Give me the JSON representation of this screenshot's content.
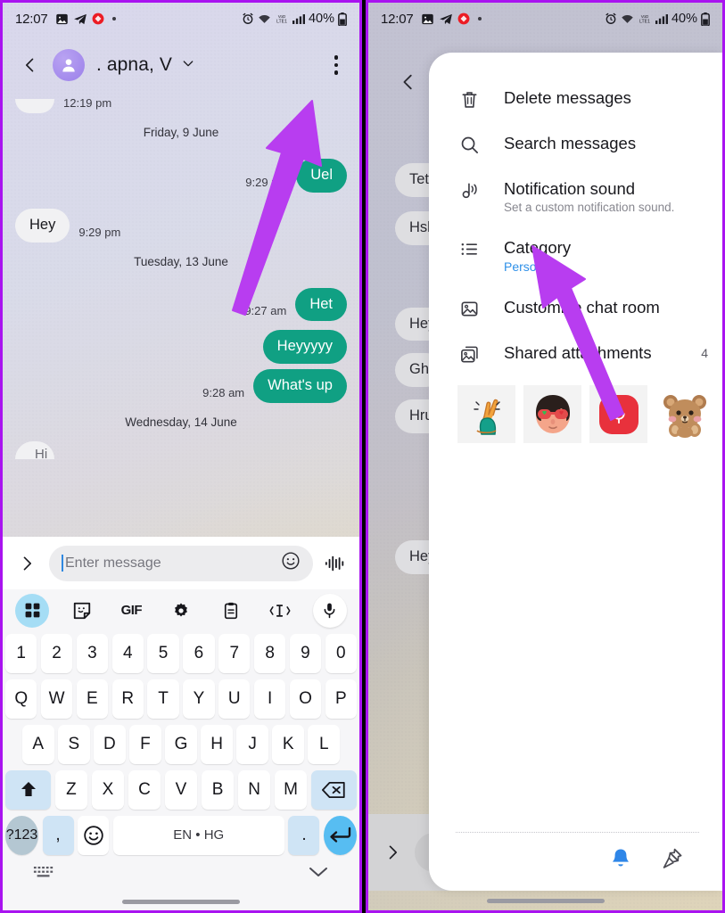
{
  "status_bar": {
    "time": "12:07",
    "left_icons": [
      "photo-icon",
      "telegram-icon",
      "record-icon",
      "dot-icon"
    ],
    "right_icons": [
      "alarm-icon",
      "wifi-icon",
      "volte-icon",
      "signal-icon"
    ],
    "battery": "40%"
  },
  "left_phone": {
    "header": {
      "back": "back-icon",
      "title": ". apna, V",
      "chevron": "chevron-down-icon",
      "more": "more-vertical-icon"
    },
    "messages": [
      {
        "type": "in-clip",
        "text": "",
        "time": "12:19 pm"
      },
      {
        "type": "day",
        "text": "Friday, 9 June"
      },
      {
        "type": "out",
        "text": "Uel",
        "time": "9:29 pm"
      },
      {
        "type": "in",
        "text": "Hey",
        "time": "9:29 pm"
      },
      {
        "type": "day",
        "text": "Tuesday, 13 June"
      },
      {
        "type": "out",
        "text": "Het",
        "time": "9:27 am"
      },
      {
        "type": "out",
        "text": "Heyyyyy",
        "time": ""
      },
      {
        "type": "out",
        "text": "What's up",
        "time": "9:28 am"
      },
      {
        "type": "day",
        "text": "Wednesday, 14 June"
      },
      {
        "type": "in-clip-bottom",
        "text": "Hi",
        "time": ""
      }
    ],
    "composer": {
      "expand_icon": "chevron-right-icon",
      "placeholder": "Enter message",
      "emoji_icon": "emoji-icon",
      "voice_icon": "voice-waveform-icon"
    },
    "keyboard": {
      "toolbar": [
        "grid-icon",
        "sticker-icon",
        "GIF",
        "settings-icon",
        "clipboard-icon",
        "text-cursor-icon",
        "microphone-icon"
      ],
      "row_numbers": [
        "1",
        "2",
        "3",
        "4",
        "5",
        "6",
        "7",
        "8",
        "9",
        "0"
      ],
      "row_top": [
        "Q",
        "W",
        "E",
        "R",
        "T",
        "Y",
        "U",
        "I",
        "O",
        "P"
      ],
      "row_mid": [
        "A",
        "S",
        "D",
        "F",
        "G",
        "H",
        "J",
        "K",
        "L"
      ],
      "row_bot": [
        "Z",
        "X",
        "C",
        "V",
        "B",
        "N",
        "M"
      ],
      "shift_icon": "shift-icon",
      "backspace_icon": "backspace-icon",
      "symbols_key": "?123",
      "comma_key": ",",
      "emoji_key": "emoji-icon",
      "space_key": "EN • HG",
      "period_key": ".",
      "enter_icon": "enter-icon",
      "hide_keyboard_icon": "keyboard-hide-icon",
      "collapse_icon": "chevron-down-icon"
    }
  },
  "right_phone": {
    "back": "back-icon",
    "ghost_messages": [
      "Tets",
      "Hsh",
      "Hey",
      "Gh",
      "Hru",
      "Hey"
    ],
    "menu": {
      "items": [
        {
          "icon": "trash-icon",
          "title": "Delete messages",
          "sub": "",
          "count": ""
        },
        {
          "icon": "search-icon",
          "title": "Search messages",
          "sub": "",
          "count": ""
        },
        {
          "icon": "music-note-icon",
          "title": "Notification sound",
          "sub": "Set a custom notification sound.",
          "count": ""
        },
        {
          "icon": "list-icon",
          "title": "Category",
          "sub": "Personal",
          "count": ""
        },
        {
          "icon": "image-icon",
          "title": "Customise chat room",
          "sub": "",
          "count": ""
        },
        {
          "icon": "images-icon",
          "title": "Shared attachments",
          "sub": "",
          "count": "4"
        }
      ],
      "thumbnails": [
        "crossed-fingers-sticker",
        "heart-eyes-face-sticker",
        "voice-recording-icon",
        "bear-sticker"
      ],
      "actions": [
        "notification-bell-icon",
        "pin-icon"
      ]
    },
    "composer": {
      "expand_icon": "chevron-right-icon"
    }
  },
  "colors": {
    "accent_purple": "#b83df0",
    "bubble_out": "#10a083",
    "bubble_in": "#f1f1f3",
    "link_blue": "#2e90e8",
    "frame": "#a913f0"
  }
}
